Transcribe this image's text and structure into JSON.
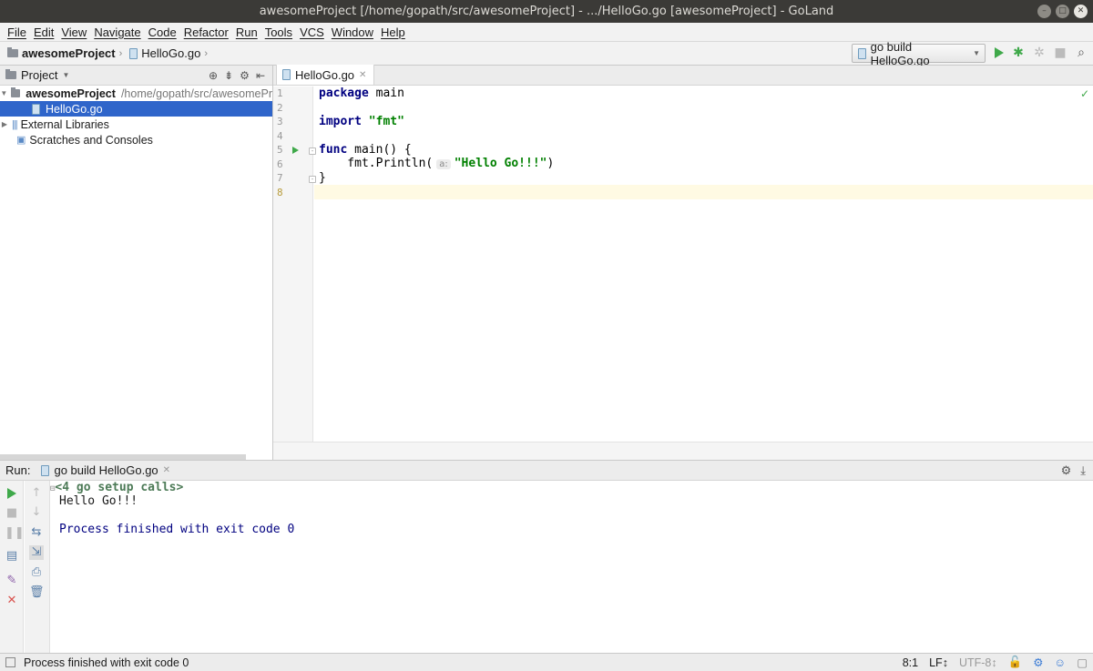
{
  "window": {
    "title": "awesomeProject [/home/gopath/src/awesomeProject] - .../HelloGo.go [awesomeProject] - GoLand"
  },
  "menu": [
    "File",
    "Edit",
    "View",
    "Navigate",
    "Code",
    "Refactor",
    "Run",
    "Tools",
    "VCS",
    "Window",
    "Help"
  ],
  "breadcrumb": {
    "project": "awesomeProject",
    "file": "HelloGo.go"
  },
  "run_config": {
    "label": "go build HelloGo.go"
  },
  "project_panel": {
    "title": "Project",
    "tree": [
      {
        "label": "awesomeProject",
        "path": "/home/gopath/src/awesomePr"
      },
      {
        "label": "HelloGo.go"
      },
      {
        "label": "External Libraries"
      },
      {
        "label": "Scratches and Consoles"
      }
    ]
  },
  "editor": {
    "tab": "HelloGo.go",
    "line_numbers": [
      "1",
      "2",
      "3",
      "4",
      "5",
      "6",
      "7",
      "8"
    ],
    "code": {
      "l1_kw": "package",
      "l1_rest": " main",
      "l3_kw": "import",
      "l3_str": "\"fmt\"",
      "l5_kw": "func",
      "l5_rest": " main() {",
      "l6_pre": "    fmt.Println(",
      "l6_hint": "a:",
      "l6_str": "\"Hello Go!!!\"",
      "l6_post": ")",
      "l7": "}"
    }
  },
  "run_panel": {
    "label": "Run:",
    "tab": "go build HelloGo.go",
    "console": {
      "setup": "<4 go setup calls>",
      "output": "Hello Go!!!",
      "finished": "Process finished with exit code 0"
    }
  },
  "statusbar": {
    "message": "Process finished with exit code 0",
    "position": "8:1",
    "line_sep": "LF↕",
    "encoding": "UTF-8",
    "encoding_arrow": "↕"
  }
}
